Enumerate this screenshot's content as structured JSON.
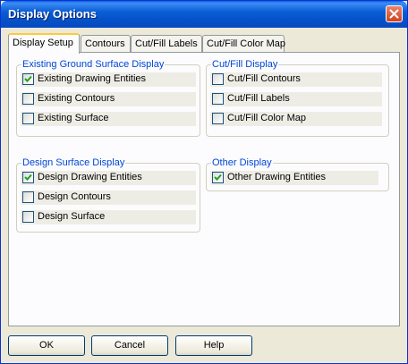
{
  "window": {
    "title": "Display Options"
  },
  "tabs": [
    {
      "label": "Display Setup",
      "active": true
    },
    {
      "label": "Contours",
      "active": false
    },
    {
      "label": "Cut/Fill Labels",
      "active": false
    },
    {
      "label": "Cut/Fill Color Map",
      "active": false
    }
  ],
  "groups": {
    "existing_ground": {
      "title": "Existing Ground Surface Display",
      "items": [
        {
          "label": "Existing Drawing Entities",
          "checked": true
        },
        {
          "label": "Existing Contours",
          "checked": false
        },
        {
          "label": "Existing Surface",
          "checked": false
        }
      ]
    },
    "cut_fill": {
      "title": "Cut/Fill Display",
      "items": [
        {
          "label": "Cut/Fill Contours",
          "checked": false
        },
        {
          "label": "Cut/Fill Labels",
          "checked": false
        },
        {
          "label": "Cut/Fill Color Map",
          "checked": false
        }
      ]
    },
    "design_surface": {
      "title": "Design Surface Display",
      "items": [
        {
          "label": "Design Drawing Entities",
          "checked": true
        },
        {
          "label": "Design Contours",
          "checked": false
        },
        {
          "label": "Design Surface",
          "checked": false
        }
      ]
    },
    "other": {
      "title": "Other Display",
      "items": [
        {
          "label": "Other Drawing Entities",
          "checked": true
        }
      ]
    }
  },
  "buttons": {
    "ok": "OK",
    "cancel": "Cancel",
    "help": "Help"
  },
  "colors": {
    "title_bar": "#0b5ed6",
    "group_title": "#0046d5",
    "checkmark": "#21a121",
    "active_tab_accent": "#ffc83c",
    "close_button": "#d1431d"
  },
  "icons": {
    "close": "close-x-icon",
    "check": "checkmark-icon"
  }
}
